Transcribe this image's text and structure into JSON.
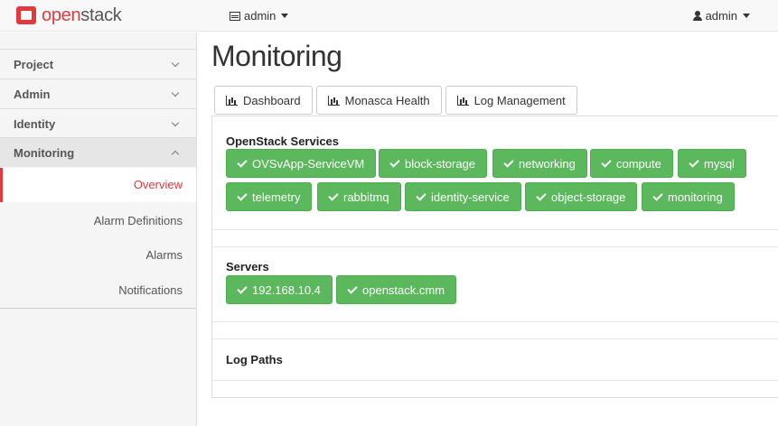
{
  "brand": {
    "name_part1": "open",
    "name_part2": "stack",
    "accent": "#e03a3e"
  },
  "header": {
    "project_label": "admin",
    "user_label": "admin"
  },
  "sidebar": {
    "sections": [
      {
        "label": "Project"
      },
      {
        "label": "Admin"
      },
      {
        "label": "Identity"
      },
      {
        "label": "Monitoring"
      }
    ],
    "items": [
      {
        "label": "Overview"
      },
      {
        "label": "Alarm Definitions"
      },
      {
        "label": "Alarms"
      },
      {
        "label": "Notifications"
      }
    ]
  },
  "main": {
    "title": "Monitoring",
    "tabs": [
      {
        "label": "Dashboard",
        "icon": "bar-chart-icon"
      },
      {
        "label": "Monasca Health",
        "icon": "bar-chart-icon"
      },
      {
        "label": "Log Management",
        "icon": "bar-chart-icon"
      }
    ],
    "services": {
      "title": "OpenStack Services",
      "items": [
        "OVSvApp-ServiceVM",
        "block-storage",
        "networking",
        "compute",
        "mysql",
        "telemetry",
        "rabbitmq",
        "identity-service",
        "object-storage",
        "monitoring"
      ]
    },
    "servers": {
      "title": "Servers",
      "items": [
        "192.168.10.4",
        "openstack.cmm"
      ]
    },
    "logs": {
      "title": "Log Paths"
    }
  },
  "colors": {
    "ok_green": "#5cb85c",
    "active_red": "#e03a3e"
  }
}
